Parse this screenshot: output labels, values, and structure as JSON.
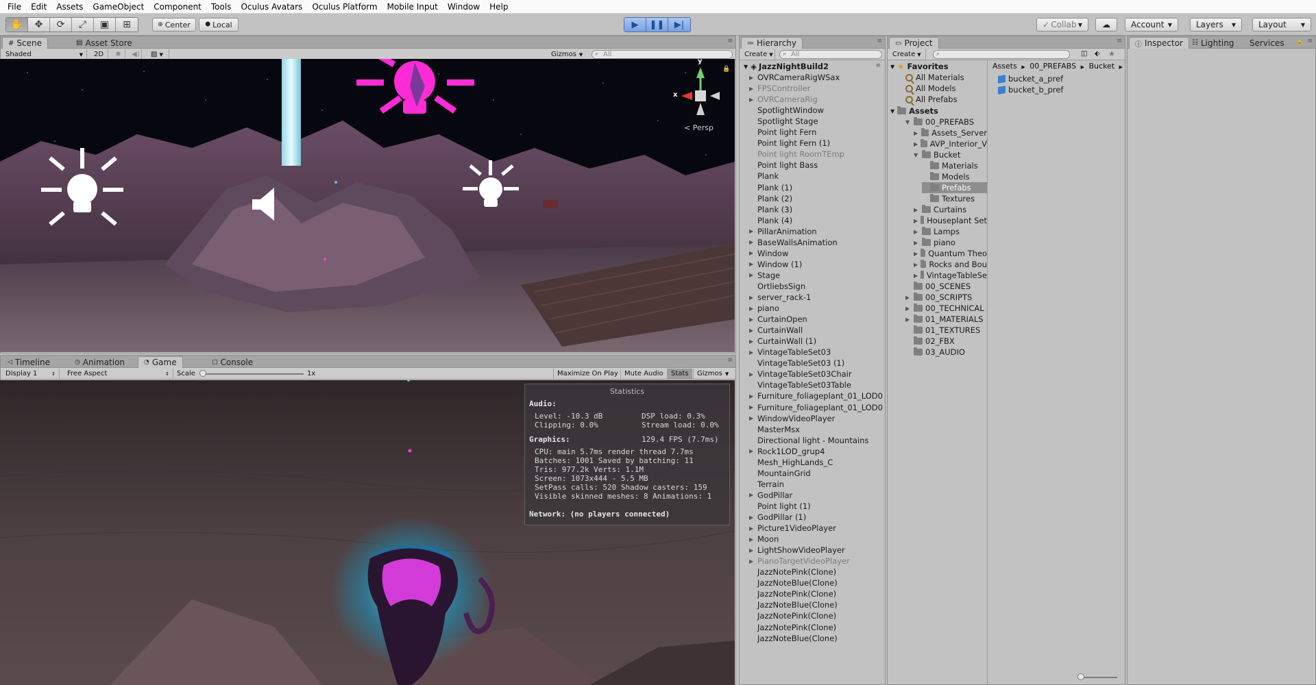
{
  "menu": [
    "File",
    "Edit",
    "Assets",
    "GameObject",
    "Component",
    "Tools",
    "Oculus Avatars",
    "Oculus Platform",
    "Mobile Input",
    "Window",
    "Help"
  ],
  "toolbar": {
    "pivot": "Center",
    "space": "Local",
    "collab": "Collab",
    "account": "Account",
    "layers": "Layers",
    "layout": "Layout",
    "tool_icons": [
      "hand-icon",
      "move-icon",
      "rotate-icon",
      "scale-icon",
      "rect-icon",
      "transform-icon"
    ],
    "play_icons": [
      "play-icon",
      "pause-icon",
      "step-icon"
    ]
  },
  "scene": {
    "tabs": [
      "Scene",
      "Asset Store"
    ],
    "shading": "Shaded",
    "mode_2d": "2D",
    "gizmos": "Gizmos",
    "search_placeholder": "All",
    "persp_label": "Persp",
    "axis_x": "x",
    "axis_y": "y"
  },
  "game": {
    "tabs": [
      "Timeline",
      "Animation",
      "Game",
      "Console"
    ],
    "display": "Display 1",
    "aspect": "Free Aspect",
    "scale_label": "Scale",
    "scale_value": "1x",
    "buttons": [
      "Maximize On Play",
      "Mute Audio",
      "Stats",
      "Gizmos"
    ]
  },
  "stats": {
    "title": "Statistics",
    "audio_header": "Audio:",
    "level": "Level: -10.3 dB",
    "dsp": "DSP load: 0.3%",
    "clipping": "Clipping: 0.0%",
    "stream": "Stream load: 0.0%",
    "graphics_header": "Graphics:",
    "fps": "129.4 FPS (7.7ms)",
    "cpu": "CPU: main 5.7ms  render thread 7.7ms",
    "batches": "Batches: 1001   Saved by batching: 11",
    "tris": "Tris: 977.2k         Verts: 1.1M",
    "screen": "Screen: 1073x444 - 5.5 MB",
    "setpass": "SetPass calls: 520   Shadow casters: 159",
    "skinned": "Visible skinned meshes: 8  Animations: 1",
    "network": "Network: (no players connected)"
  },
  "hierarchy": {
    "tab": "Hierarchy",
    "create": "Create",
    "search_placeholder": "All",
    "scene_name": "JazzNightBuild2",
    "items": [
      {
        "label": "OVRCameraRigWSax",
        "fold": true,
        "disabled": false
      },
      {
        "label": "FPSController",
        "fold": true,
        "disabled": true
      },
      {
        "label": "OVRCameraRig",
        "fold": true,
        "disabled": true
      },
      {
        "label": "SpotlightWindow",
        "fold": false,
        "disabled": false
      },
      {
        "label": "Spotlight Stage",
        "fold": false,
        "disabled": false
      },
      {
        "label": "Point light Fern",
        "fold": false,
        "disabled": false
      },
      {
        "label": "Point light Fern (1)",
        "fold": false,
        "disabled": false
      },
      {
        "label": "Point light RoomTEmp",
        "fold": false,
        "disabled": true
      },
      {
        "label": "Point light Bass",
        "fold": false,
        "disabled": false
      },
      {
        "label": "Plank",
        "fold": false,
        "disabled": false
      },
      {
        "label": "Plank (1)",
        "fold": false,
        "disabled": false
      },
      {
        "label": "Plank (2)",
        "fold": false,
        "disabled": false
      },
      {
        "label": "Plank (3)",
        "fold": false,
        "disabled": false
      },
      {
        "label": "Plank (4)",
        "fold": false,
        "disabled": false
      },
      {
        "label": "PillarAnimation",
        "fold": true,
        "disabled": false
      },
      {
        "label": "BaseWallsAnimation",
        "fold": true,
        "disabled": false
      },
      {
        "label": "Window",
        "fold": true,
        "disabled": false
      },
      {
        "label": "Window (1)",
        "fold": true,
        "disabled": false
      },
      {
        "label": "Stage",
        "fold": true,
        "disabled": false
      },
      {
        "label": "OrtliebsSign",
        "fold": false,
        "disabled": false
      },
      {
        "label": "server_rack-1",
        "fold": true,
        "disabled": false
      },
      {
        "label": "piano",
        "fold": true,
        "disabled": false
      },
      {
        "label": "CurtainOpen",
        "fold": true,
        "disabled": false
      },
      {
        "label": "CurtainWall",
        "fold": true,
        "disabled": false
      },
      {
        "label": "CurtainWall (1)",
        "fold": true,
        "disabled": false
      },
      {
        "label": "VintageTableSet03",
        "fold": true,
        "disabled": false
      },
      {
        "label": "VintageTableSet03 (1)",
        "fold": false,
        "disabled": false
      },
      {
        "label": "VintageTableSet03Chair",
        "fold": true,
        "disabled": false
      },
      {
        "label": "VintageTableSet03Table",
        "fold": false,
        "disabled": false
      },
      {
        "label": "Furniture_foliageplant_01_LOD0",
        "fold": true,
        "disabled": false
      },
      {
        "label": "Furniture_foliageplant_01_LOD0",
        "fold": true,
        "disabled": false
      },
      {
        "label": "WindowVideoPlayer",
        "fold": true,
        "disabled": false
      },
      {
        "label": "MasterMsx",
        "fold": false,
        "disabled": false
      },
      {
        "label": "Directional light - Mountains",
        "fold": false,
        "disabled": false
      },
      {
        "label": "Rock1LOD_grup4",
        "fold": true,
        "disabled": false
      },
      {
        "label": "Mesh_HighLands_C",
        "fold": false,
        "disabled": false
      },
      {
        "label": "MountainGrid",
        "fold": false,
        "disabled": false
      },
      {
        "label": "Terrain",
        "fold": false,
        "disabled": false
      },
      {
        "label": "GodPillar",
        "fold": true,
        "disabled": false
      },
      {
        "label": "Point light (1)",
        "fold": false,
        "disabled": false
      },
      {
        "label": "GodPillar (1)",
        "fold": true,
        "disabled": false
      },
      {
        "label": "Picture1VideoPlayer",
        "fold": true,
        "disabled": false
      },
      {
        "label": "Moon",
        "fold": true,
        "disabled": false
      },
      {
        "label": "LightShowVideoPlayer",
        "fold": true,
        "disabled": false
      },
      {
        "label": "PianoTargetVideoPlayer",
        "fold": true,
        "disabled": true
      },
      {
        "label": "JazzNotePink(Clone)",
        "fold": false,
        "disabled": false
      },
      {
        "label": "JazzNoteBlue(Clone)",
        "fold": false,
        "disabled": false
      },
      {
        "label": "JazzNotePink(Clone)",
        "fold": false,
        "disabled": false
      },
      {
        "label": "JazzNoteBlue(Clone)",
        "fold": false,
        "disabled": false
      },
      {
        "label": "JazzNotePink(Clone)",
        "fold": false,
        "disabled": false
      },
      {
        "label": "JazzNotePink(Clone)",
        "fold": false,
        "disabled": false
      },
      {
        "label": "JazzNoteBlue(Clone)",
        "fold": false,
        "disabled": false
      }
    ]
  },
  "project": {
    "tab": "Project",
    "create": "Create",
    "favorites_label": "Favorites",
    "favorites": [
      "All Materials",
      "All Models",
      "All Prefabs"
    ],
    "assets_label": "Assets",
    "tree": [
      {
        "label": "00_PREFABS",
        "depth": 1,
        "fold": "open",
        "selected": false
      },
      {
        "label": "Assets_Server",
        "depth": 2,
        "fold": "closed",
        "selected": false
      },
      {
        "label": "AVP_Interior_V",
        "depth": 2,
        "fold": "closed",
        "selected": false
      },
      {
        "label": "Bucket",
        "depth": 2,
        "fold": "open",
        "selected": false
      },
      {
        "label": "Materials",
        "depth": 3,
        "fold": "none",
        "selected": false
      },
      {
        "label": "Models",
        "depth": 3,
        "fold": "none",
        "selected": false
      },
      {
        "label": "Prefabs",
        "depth": 3,
        "fold": "none",
        "selected": true
      },
      {
        "label": "Textures",
        "depth": 3,
        "fold": "none",
        "selected": false
      },
      {
        "label": "Curtains",
        "depth": 2,
        "fold": "closed",
        "selected": false
      },
      {
        "label": "Houseplant Set",
        "depth": 2,
        "fold": "closed",
        "selected": false
      },
      {
        "label": "Lamps",
        "depth": 2,
        "fold": "closed",
        "selected": false
      },
      {
        "label": "piano",
        "depth": 2,
        "fold": "closed",
        "selected": false
      },
      {
        "label": "Quantum Theo",
        "depth": 2,
        "fold": "closed",
        "selected": false
      },
      {
        "label": "Rocks and Bou",
        "depth": 2,
        "fold": "closed",
        "selected": false
      },
      {
        "label": "VintageTableSe",
        "depth": 2,
        "fold": "closed",
        "selected": false
      },
      {
        "label": "00_SCENES",
        "depth": 1,
        "fold": "none",
        "selected": false
      },
      {
        "label": "00_SCRIPTS",
        "depth": 1,
        "fold": "closed",
        "selected": false
      },
      {
        "label": "00_TECHNICAL",
        "depth": 1,
        "fold": "closed",
        "selected": false
      },
      {
        "label": "01_MATERIALS",
        "depth": 1,
        "fold": "closed",
        "selected": false
      },
      {
        "label": "01_TEXTURES",
        "depth": 1,
        "fold": "none",
        "selected": false
      },
      {
        "label": "02_FBX",
        "depth": 1,
        "fold": "none",
        "selected": false
      },
      {
        "label": "03_AUDIO",
        "depth": 1,
        "fold": "none",
        "selected": false
      }
    ],
    "breadcrumb": [
      "Assets",
      "00_PREFABS",
      "Bucket"
    ],
    "files": [
      "bucket_a_pref",
      "bucket_b_pref"
    ]
  },
  "inspector": {
    "tabs": [
      "Inspector",
      "Lighting",
      "Services"
    ]
  }
}
